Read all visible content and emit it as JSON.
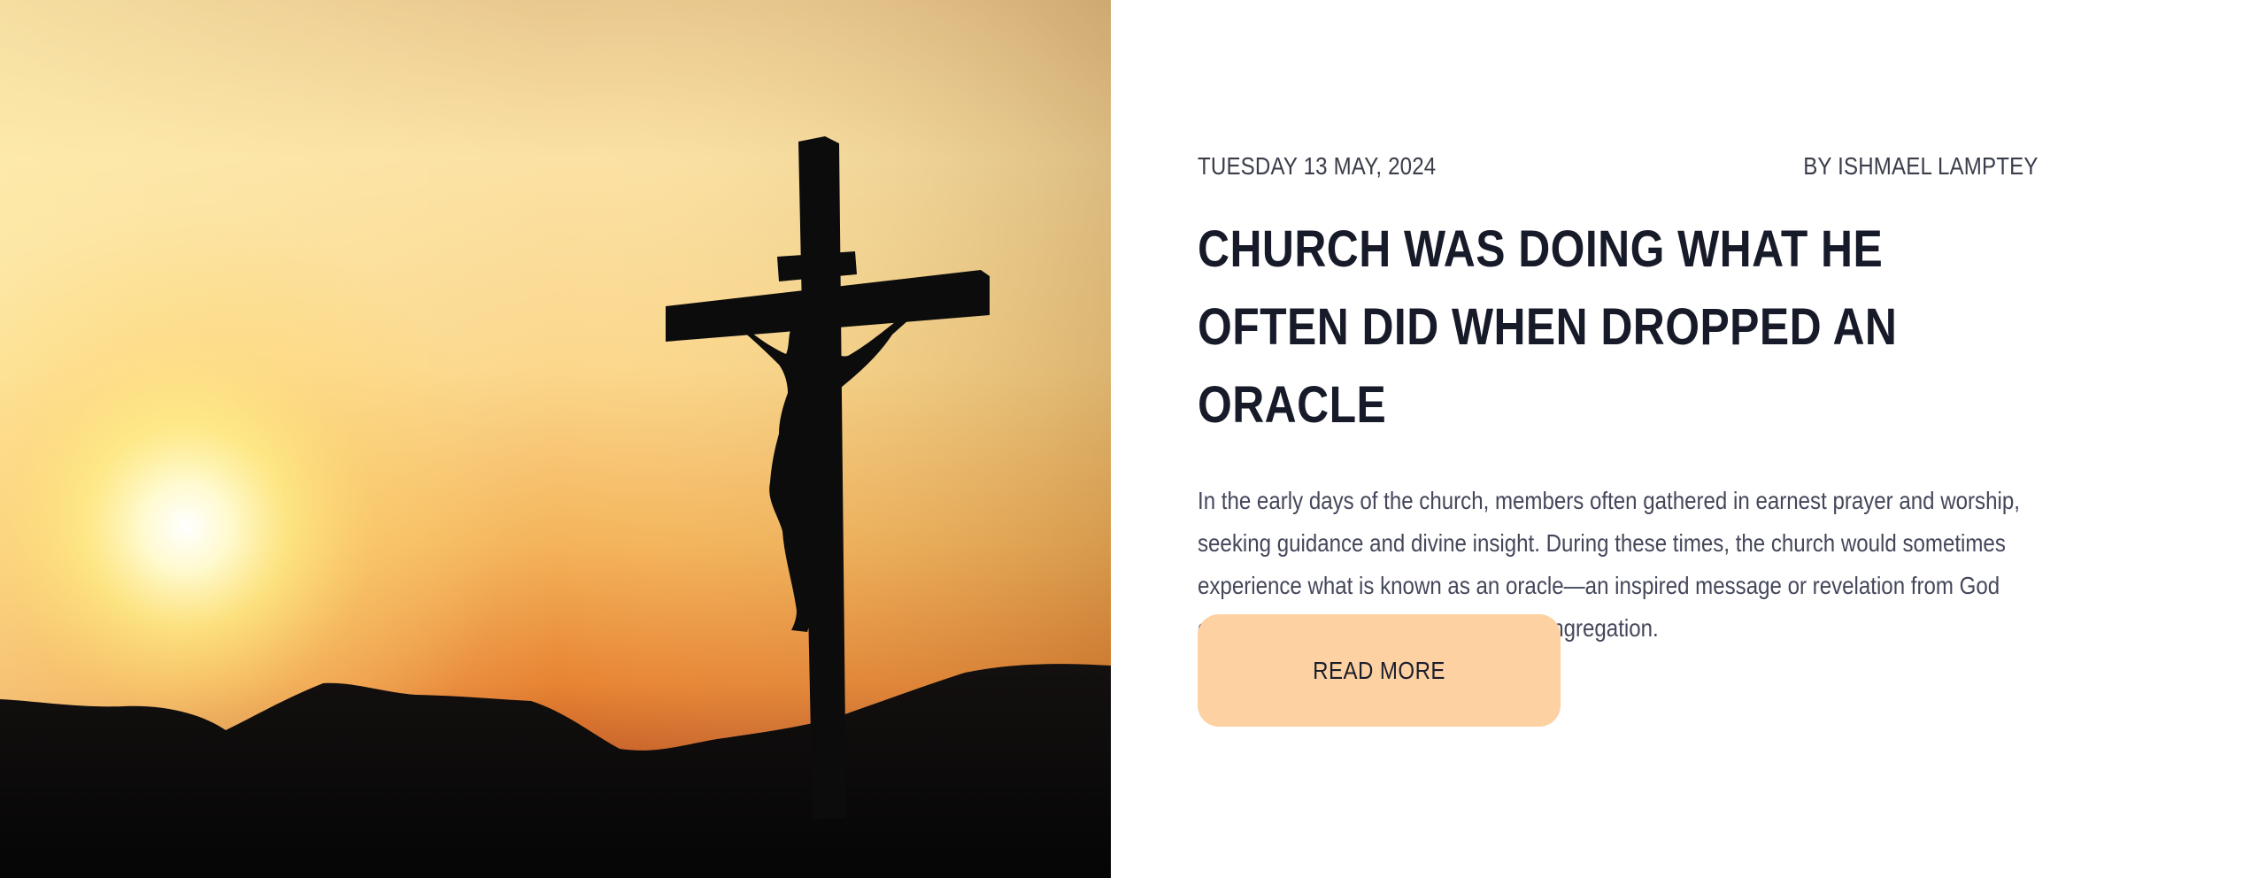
{
  "hero": {
    "image": "crucifix-silhouette-sunset",
    "colors": {
      "sky_top": "#d7b588",
      "sky_mid": "#fbe3a2",
      "sun": "#fff7a8",
      "horizon": "#ea8f34",
      "ground": "#080808"
    }
  },
  "post": {
    "date": "TUESDAY 13 MAY, 2024",
    "author": "BY ISHMAEL LAMPTEY",
    "title": "CHURCH WAS DOING WHAT HE OFTEN DID WHEN DROPPED AN ORACLE",
    "excerpt": "In the early days of the church, members often gathered in earnest prayer and worship, seeking guidance and divine insight. During these times, the church would sometimes experience what is known as an oracle—an inspired message or revelation from God delivered through a member of the congregation.",
    "read_more_label": "READ MORE"
  },
  "colors": {
    "button_bg": "#fdd1a1",
    "title": "#171a28",
    "text": "#44475a"
  }
}
